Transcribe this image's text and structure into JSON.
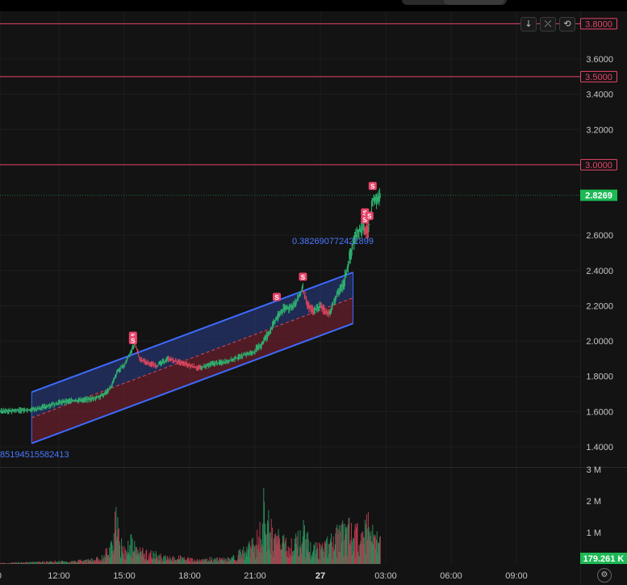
{
  "chart_data": {
    "type": "candlestick",
    "x_ticks": [
      "0",
      "12:00",
      "15:00",
      "18:00",
      "21:00",
      "27",
      "03:00",
      "06:00",
      "09:00"
    ],
    "price_axis": {
      "ticks": [
        "1.4000",
        "1.6000",
        "1.8000",
        "2.0000",
        "2.2000",
        "2.4000",
        "2.6000",
        "3.2000",
        "3.4000",
        "3.6000"
      ],
      "range": [
        1.33,
        3.87
      ]
    },
    "volume_axis": {
      "ticks": [
        "1 M",
        "2 M",
        "3 M"
      ],
      "range": [
        0,
        3000000
      ]
    },
    "current_price": {
      "label": "2.8269",
      "value": 2.8269,
      "color": "#1db954"
    },
    "current_volume": {
      "label": "179.261 K",
      "color": "#1db954"
    },
    "horizontal_levels": [
      {
        "label": "3.8000",
        "value": 3.8,
        "color": "#e8456a"
      },
      {
        "label": "3.5000",
        "value": 3.5,
        "color": "#e8456a"
      },
      {
        "label": "3.0000",
        "value": 3.0,
        "color": "#e8456a"
      }
    ],
    "channel": {
      "upper": [
        [
          10.75,
          1.71
        ],
        [
          25.5,
          2.39
        ]
      ],
      "lower": [
        [
          10.75,
          1.42
        ],
        [
          25.5,
          2.1
        ]
      ],
      "midline": [
        [
          10.75,
          1.565
        ],
        [
          25.5,
          2.245
        ]
      ],
      "upper_fill": "#2a3f8a",
      "lower_fill": "#7a2230",
      "line_color": "#3e6bff"
    },
    "annotations": [
      {
        "text": "0.382690772421899",
        "color": "#4a78ff"
      },
      {
        "text": "85194515582413",
        "color": "#4a78ff"
      }
    ],
    "sell_marker_label": "S",
    "sell_markers": [
      {
        "x": 15.4,
        "y": 2.03
      },
      {
        "x": 15.4,
        "y": 2.005
      },
      {
        "x": 22.0,
        "y": 2.25
      },
      {
        "x": 23.2,
        "y": 2.365
      },
      {
        "x": 26.05,
        "y": 2.73
      },
      {
        "x": 26.05,
        "y": 2.69
      },
      {
        "x": 26.25,
        "y": 2.71
      },
      {
        "x": 26.4,
        "y": 2.88
      }
    ],
    "price_path": [
      [
        6.0,
        1.605
      ],
      [
        7.0,
        1.6
      ],
      [
        8.0,
        1.605
      ],
      [
        9.0,
        1.6
      ],
      [
        10.0,
        1.605
      ],
      [
        11.0,
        1.615
      ],
      [
        12.0,
        1.65
      ],
      [
        12.5,
        1.66
      ],
      [
        13.0,
        1.665
      ],
      [
        13.5,
        1.67
      ],
      [
        14.0,
        1.69
      ],
      [
        14.4,
        1.74
      ],
      [
        14.7,
        1.83
      ],
      [
        15.0,
        1.86
      ],
      [
        15.3,
        1.94
      ],
      [
        15.5,
        1.99
      ],
      [
        15.7,
        1.9
      ],
      [
        16.0,
        1.88
      ],
      [
        16.5,
        1.86
      ],
      [
        17.0,
        1.9
      ],
      [
        17.5,
        1.88
      ],
      [
        18.0,
        1.86
      ],
      [
        18.5,
        1.845
      ],
      [
        19.0,
        1.87
      ],
      [
        19.5,
        1.88
      ],
      [
        20.0,
        1.895
      ],
      [
        20.5,
        1.92
      ],
      [
        21.0,
        1.94
      ],
      [
        21.3,
        1.98
      ],
      [
        21.7,
        2.06
      ],
      [
        22.0,
        2.13
      ],
      [
        22.3,
        2.18
      ],
      [
        22.6,
        2.19
      ],
      [
        22.9,
        2.22
      ],
      [
        23.2,
        2.3
      ],
      [
        23.4,
        2.2
      ],
      [
        23.7,
        2.17
      ],
      [
        24.0,
        2.2
      ],
      [
        24.4,
        2.15
      ],
      [
        24.8,
        2.27
      ],
      [
        25.1,
        2.34
      ],
      [
        25.3,
        2.45
      ],
      [
        25.5,
        2.55
      ],
      [
        25.7,
        2.62
      ],
      [
        26.0,
        2.64
      ],
      [
        26.2,
        2.62
      ],
      [
        26.4,
        2.8
      ],
      [
        26.6,
        2.8
      ],
      [
        26.75,
        2.8269
      ]
    ],
    "volume_series": [
      [
        6.0,
        20000
      ],
      [
        7.0,
        30000
      ],
      [
        8.0,
        40000
      ],
      [
        9.0,
        30000
      ],
      [
        10.0,
        60000
      ],
      [
        11.0,
        80000
      ],
      [
        12.0,
        120000
      ],
      [
        12.5,
        100000
      ],
      [
        13.0,
        150000
      ],
      [
        13.5,
        180000
      ],
      [
        14.0,
        300000
      ],
      [
        14.4,
        900000
      ],
      [
        14.6,
        2000000
      ],
      [
        14.8,
        1000000
      ],
      [
        15.0,
        600000
      ],
      [
        15.3,
        1000000
      ],
      [
        15.5,
        700000
      ],
      [
        16.0,
        500000
      ],
      [
        16.5,
        400000
      ],
      [
        17.0,
        250000
      ],
      [
        17.5,
        300000
      ],
      [
        18.0,
        200000
      ],
      [
        18.5,
        150000
      ],
      [
        19.0,
        250000
      ],
      [
        19.5,
        200000
      ],
      [
        20.0,
        300000
      ],
      [
        20.5,
        600000
      ],
      [
        21.0,
        900000
      ],
      [
        21.3,
        1500000
      ],
      [
        21.4,
        2800000
      ],
      [
        21.6,
        1800000
      ],
      [
        22.0,
        1200000
      ],
      [
        22.5,
        800000
      ],
      [
        23.0,
        1100000
      ],
      [
        23.2,
        1500000
      ],
      [
        23.5,
        900000
      ],
      [
        24.0,
        700000
      ],
      [
        24.5,
        1000000
      ],
      [
        25.0,
        1500000
      ],
      [
        25.3,
        1800000
      ],
      [
        25.6,
        1400000
      ],
      [
        25.9,
        1100000
      ],
      [
        26.1,
        1600000
      ],
      [
        26.3,
        1700000
      ],
      [
        26.5,
        1200000
      ],
      [
        26.75,
        900000
      ]
    ]
  }
}
